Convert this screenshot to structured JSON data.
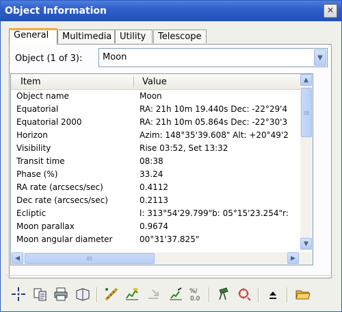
{
  "window": {
    "title": "Object Information",
    "close_glyph": "✕"
  },
  "tabs": [
    {
      "label": "General",
      "active": true
    },
    {
      "label": "Multimedia",
      "active": false
    },
    {
      "label": "Utility",
      "active": false
    },
    {
      "label": "Telescope",
      "active": false
    }
  ],
  "object_selector": {
    "label": "Object (1 of 3):",
    "value": "Moon"
  },
  "table": {
    "columns": [
      "Item",
      "Value"
    ],
    "rows": [
      {
        "item": "Object name",
        "value": "Moon"
      },
      {
        "item": "Equatorial",
        "value": "RA: 21h 10m 19.440s   Dec: -22°29'4"
      },
      {
        "item": "Equatorial 2000",
        "value": "RA: 21h 10m 05.864s   Dec: -22°30'3"
      },
      {
        "item": "Horizon",
        "value": "Azim: 148°35'39.608\"   Alt: +20°49'2"
      },
      {
        "item": "Visibility",
        "value": "Rise 03:52,  Set 13:32"
      },
      {
        "item": "Transit time",
        "value": "08:38"
      },
      {
        "item": "Phase (%)",
        "value": "33.24"
      },
      {
        "item": "RA rate (arcsecs/sec)",
        "value": "0.4112"
      },
      {
        "item": "Dec rate (arcsecs/sec)",
        "value": "0.2113"
      },
      {
        "item": "Ecliptic",
        "value": "l: 313°54'29.799\"b: 05°15'23.254\"r:"
      },
      {
        "item": "Moon parallax",
        "value": "0.9674"
      },
      {
        "item": "Moon angular diameter",
        "value": "00°31'37.825\""
      }
    ]
  },
  "toolbar": {
    "icons": [
      "center-object-icon",
      "copy-icon",
      "print-icon",
      "book-icon",
      "measure-icon",
      "chart-icon",
      "arrow-disabled-icon",
      "telescope-chart-icon",
      "decimal-icon",
      "binoculars-icon",
      "target-icon",
      "upload-icon",
      "open-folder-icon"
    ]
  },
  "colors": {
    "title_bar": "#2f5ec8",
    "tab_accent": "#f7a63a",
    "scroll": "#c9daf8"
  }
}
